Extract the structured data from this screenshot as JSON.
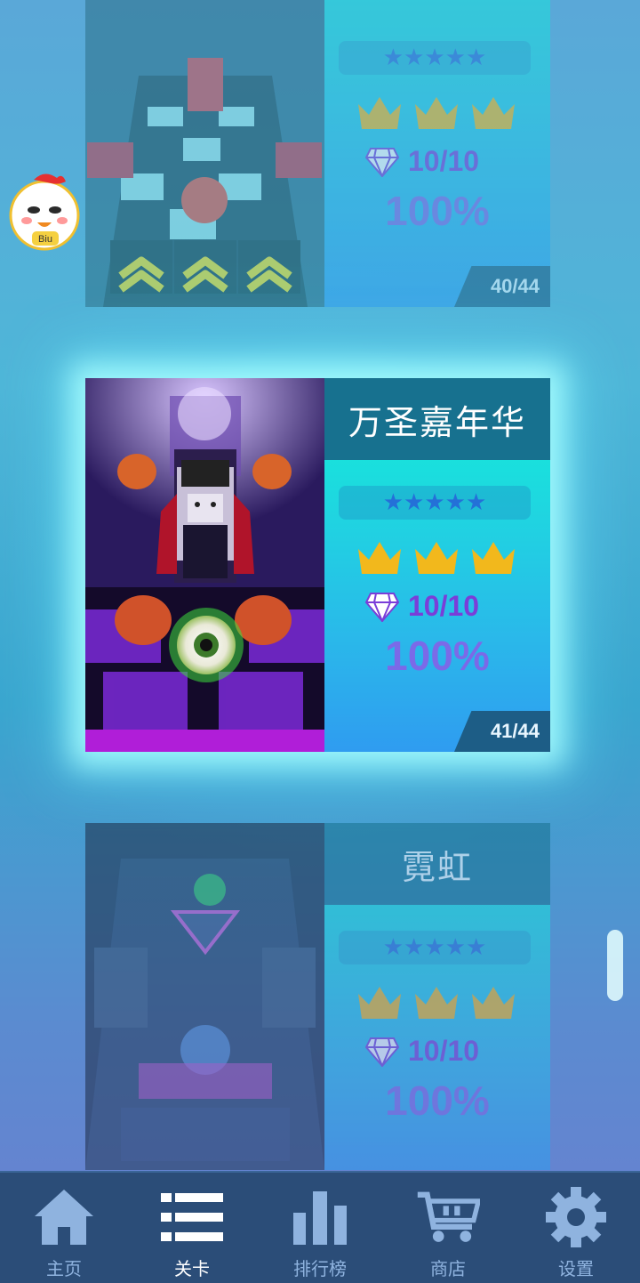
{
  "mascot": {
    "badge_text": "Biu"
  },
  "levels": [
    {
      "title": "",
      "stars": 5,
      "crowns": 3,
      "gems": "10/10",
      "percent": "100%",
      "progress": "40/44",
      "state": "dimmed"
    },
    {
      "title": "万圣嘉年华",
      "stars": 5,
      "crowns": 3,
      "gems": "10/10",
      "percent": "100%",
      "progress": "41/44",
      "state": "selected"
    },
    {
      "title": "霓虹",
      "stars": 5,
      "crowns": 3,
      "gems": "10/10",
      "percent": "100%",
      "progress": "",
      "state": "dimmed"
    }
  ],
  "star_glyphs": "★★★★★",
  "nav": {
    "items": [
      {
        "label": "主页",
        "icon": "home-icon"
      },
      {
        "label": "关卡",
        "icon": "list-icon",
        "selected": true
      },
      {
        "label": "排行榜",
        "icon": "bar-chart-icon"
      },
      {
        "label": "商店",
        "icon": "cart-icon"
      },
      {
        "label": "设置",
        "icon": "gear-icon"
      }
    ]
  },
  "colors": {
    "title_bar": "#17718f",
    "crown_gold": "#f2b81c",
    "gem_text": "#7a3ed8",
    "nav_bg": "#2b4d78"
  }
}
